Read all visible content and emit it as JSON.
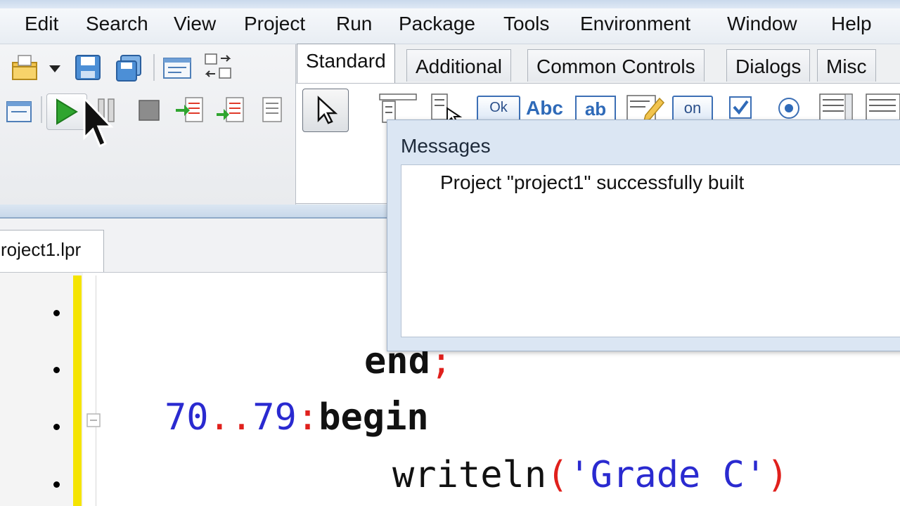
{
  "menu": {
    "items": [
      "Edit",
      "Search",
      "View",
      "Project",
      "Run",
      "Package",
      "Tools",
      "Environment",
      "Window",
      "Help"
    ]
  },
  "palette": {
    "tabs": [
      "Standard",
      "Additional",
      "Common Controls",
      "Dialogs",
      "Misc"
    ],
    "active_tab": "Standard",
    "icon_labels": {
      "ok": "Ok",
      "abc": "Abc",
      "ab": "ab",
      "on": "on"
    }
  },
  "editor": {
    "file_tab": "roject1.lpr",
    "code": {
      "line1_kw": "end",
      "line1_sym": ";",
      "line2_num1": "70",
      "line2_dots": "..",
      "line2_num2": "79",
      "line2_colon": ":",
      "line2_kw": "begin",
      "line3_fn": "writeln",
      "line3_open": "(",
      "line3_str": "'Grade C'",
      "line3_close": ")"
    }
  },
  "messages": {
    "title": "Messages",
    "text": "Project \"project1\" successfully built"
  },
  "colors": {
    "modified_bar": "#f5e400",
    "number": "#2a2ad0",
    "symbol": "#e0201c",
    "run_green": "#2fa52f"
  }
}
